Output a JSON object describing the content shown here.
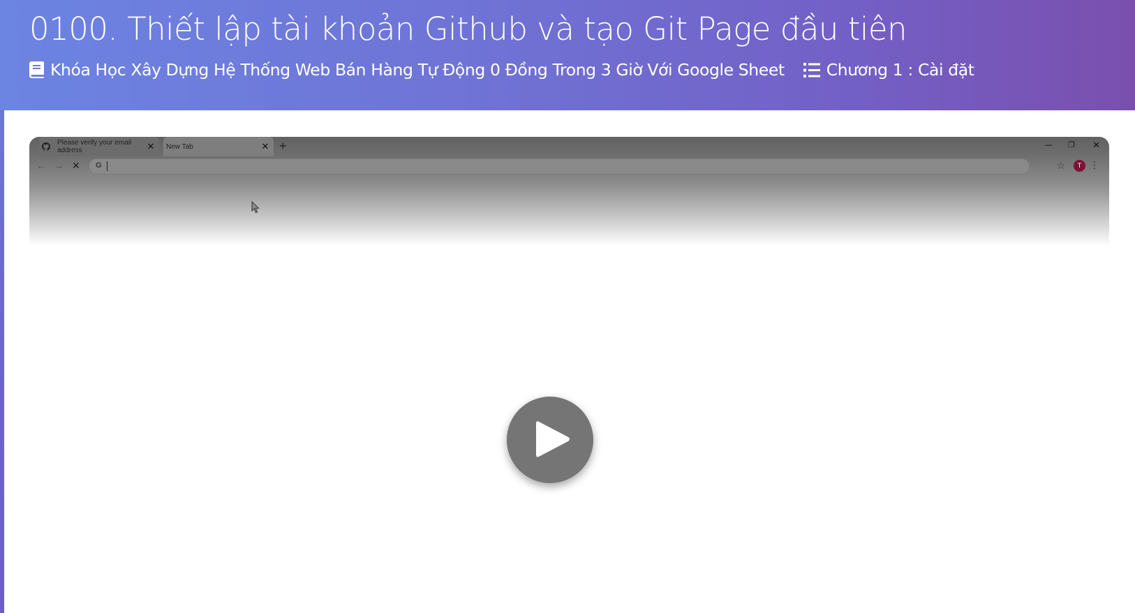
{
  "lesson": {
    "title": "0100. Thiết lập tài khoản Github và tạo Git Page đầu tiên",
    "course": "Khóa Học Xây Dựng Hệ Thống Web Bán Hàng Tự Động 0 Đồng Trong 3 Giờ Với Google Sheet",
    "chapter": "Chương 1 : Cài đặt"
  },
  "icons": {
    "course": "book-icon",
    "chapter": "list-icon",
    "tab1": "github-icon",
    "play": "play-icon"
  },
  "video": {
    "browser": {
      "tabs": [
        {
          "label": "Please verify your email address"
        },
        {
          "label": "New Tab"
        }
      ],
      "omnibox_value": "",
      "omnibox_provider": "G",
      "avatar_initial": "T"
    }
  },
  "colors": {
    "header_start": "#6c84e2",
    "header_end": "#7a4fae",
    "play_button": "#757575",
    "avatar": "#7d1035"
  }
}
